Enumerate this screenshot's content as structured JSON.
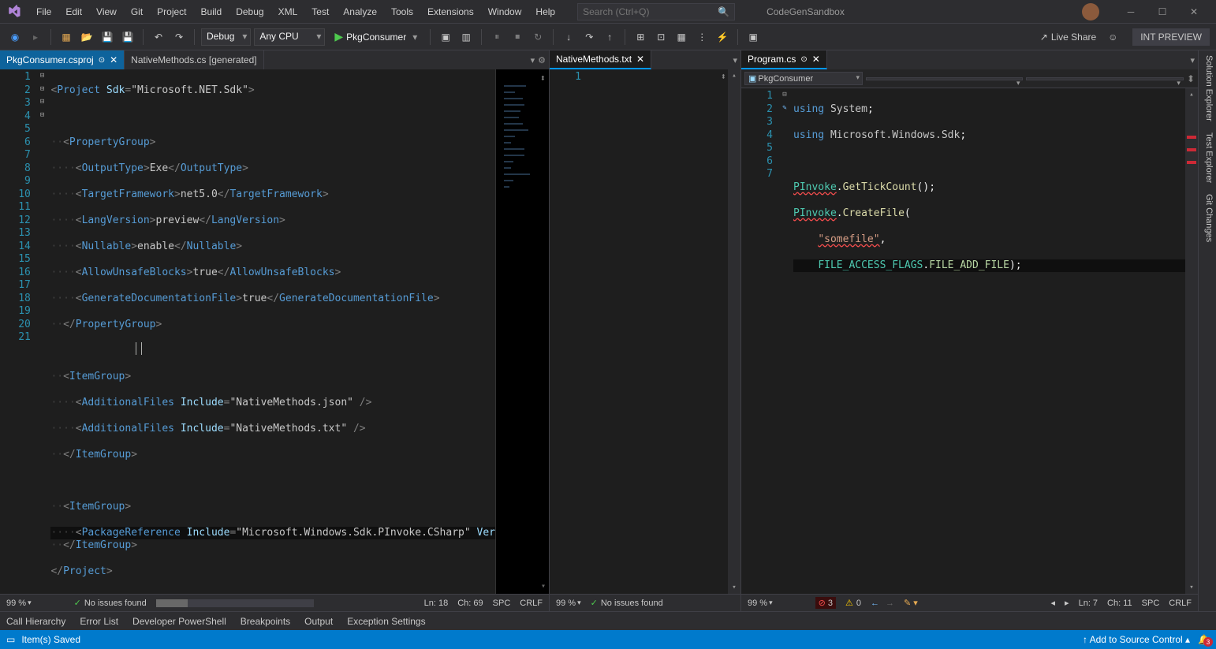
{
  "titlebar": {
    "menus": [
      "File",
      "Edit",
      "View",
      "Git",
      "Project",
      "Build",
      "Debug",
      "XML",
      "Test",
      "Analyze",
      "Tools",
      "Extensions",
      "Window",
      "Help"
    ],
    "search_placeholder": "Search (Ctrl+Q)",
    "solution_name": "CodeGenSandbox"
  },
  "toolbar": {
    "config": "Debug",
    "platform": "Any CPU",
    "start_target": "PkgConsumer",
    "live_share": "Live Share",
    "int_preview": "INT PREVIEW"
  },
  "editor1": {
    "tabs": [
      {
        "label": "PkgConsumer.csproj",
        "pinned": true,
        "active": true
      },
      {
        "label": "NativeMethods.cs [generated]",
        "active": false
      }
    ],
    "lines": [
      "1",
      "2",
      "3",
      "4",
      "5",
      "6",
      "7",
      "8",
      "9",
      "10",
      "11",
      "12",
      "13",
      "14",
      "15",
      "16",
      "17",
      "18",
      "19",
      "20",
      "21"
    ],
    "code": {
      "l1": {
        "o": "<",
        "t": "Project",
        "a1": "Sdk",
        "eq": "=",
        "s": "\"Microsoft.NET.Sdk\"",
        "c": ">"
      },
      "l3": {
        "d": "··",
        "o": "<",
        "t": "PropertyGroup",
        "c": ">"
      },
      "l4": {
        "d": "····",
        "o": "<",
        "t": "OutputType",
        "c": ">",
        "v": "Exe",
        "o2": "</",
        "t2": "OutputType",
        "c2": ">"
      },
      "l5": {
        "d": "····",
        "o": "<",
        "t": "TargetFramework",
        "c": ">",
        "v": "net5.0",
        "o2": "</",
        "t2": "TargetFramework",
        "c2": ">"
      },
      "l6": {
        "d": "····",
        "o": "<",
        "t": "LangVersion",
        "c": ">",
        "v": "preview",
        "o2": "</",
        "t2": "LangVersion",
        "c2": ">"
      },
      "l7": {
        "d": "····",
        "o": "<",
        "t": "Nullable",
        "c": ">",
        "v": "enable",
        "o2": "</",
        "t2": "Nullable",
        "c2": ">"
      },
      "l8": {
        "d": "····",
        "o": "<",
        "t": "AllowUnsafeBlocks",
        "c": ">",
        "v": "true",
        "o2": "</",
        "t2": "AllowUnsafeBlocks",
        "c2": ">"
      },
      "l9": {
        "d": "····",
        "o": "<",
        "t": "GenerateDocumentationFile",
        "c": ">",
        "v": "true",
        "o2": "</",
        "t2": "GenerateDocumentationFile",
        "c2": ">"
      },
      "l10": {
        "d": "··",
        "o": "</",
        "t": "PropertyGroup",
        "c": ">"
      },
      "l12": {
        "d": "··",
        "o": "<",
        "t": "ItemGroup",
        "c": ">"
      },
      "l13": {
        "d": "····",
        "o": "<",
        "t": "AdditionalFiles",
        "a": "Include",
        "eq": "=",
        "s": "\"NativeMethods.json\"",
        "sc": " />"
      },
      "l14": {
        "d": "····",
        "o": "<",
        "t": "AdditionalFiles",
        "a": "Include",
        "eq": "=",
        "s": "\"NativeMethods.txt\"",
        "sc": " />"
      },
      "l15": {
        "d": "··",
        "o": "</",
        "t": "ItemGroup",
        "c": ">"
      },
      "l17": {
        "d": "··",
        "o": "<",
        "t": "ItemGroup",
        "c": ">"
      },
      "l18": {
        "d": "····",
        "o": "<",
        "t": "PackageReference",
        "a": "Include",
        "eq": "=",
        "s": "\"Microsoft.Windows.Sdk.PInvoke.CSharp\"",
        "a2": "Ver"
      },
      "l19": {
        "d": "··",
        "o": "</",
        "t": "ItemGroup",
        "c": ">"
      },
      "l20": {
        "o": "</",
        "t": "Project",
        "c": ">"
      }
    },
    "status": {
      "zoom": "99 %",
      "issues": "No issues found",
      "ln": "Ln: 18",
      "ch": "Ch: 69",
      "ins": "SPC",
      "eol": "CRLF"
    }
  },
  "editor2": {
    "tab": "NativeMethods.txt",
    "lines": [
      "1"
    ],
    "status": {
      "zoom": "99 %",
      "issues": "No issues found"
    }
  },
  "editor3": {
    "tab": "Program.cs",
    "nav_project": "PkgConsumer",
    "lines": [
      "1",
      "2",
      "3",
      "4",
      "5",
      "6",
      "7"
    ],
    "code": {
      "l1": {
        "kw": "using",
        "sp": " ",
        "ns": "System",
        "sc": ";"
      },
      "l2": {
        "kw": "using",
        "sp": " ",
        "ns": "Microsoft.Windows.Sdk",
        "sc": ";"
      },
      "l4": {
        "cls": "PInvoke",
        "dot": ".",
        "m": "GetTickCount",
        "p": "();"
      },
      "l5": {
        "cls": "PInvoke",
        "dot": ".",
        "m": "CreateFile",
        "p": "("
      },
      "l6": {
        "s": "\"somefile\"",
        "c": ","
      },
      "l7": {
        "cls": "FILE_ACCESS_FLAGS",
        "dot": ".",
        "c": "FILE_ADD_FILE",
        "p": ");"
      }
    },
    "status": {
      "zoom": "99 %",
      "errors": "3",
      "warnings": "0",
      "ln": "Ln: 7",
      "ch": "Ch: 11",
      "ins": "SPC",
      "eol": "CRLF"
    }
  },
  "output_tabs": [
    "Call Hierarchy",
    "Error List",
    "Developer PowerShell",
    "Breakpoints",
    "Output",
    "Exception Settings"
  ],
  "statusbar": {
    "saved": "Item(s) Saved",
    "source_control": "Add to Source Control",
    "bell_count": "3"
  },
  "side_tabs": [
    "Solution Explorer",
    "Test Explorer",
    "Git Changes"
  ]
}
